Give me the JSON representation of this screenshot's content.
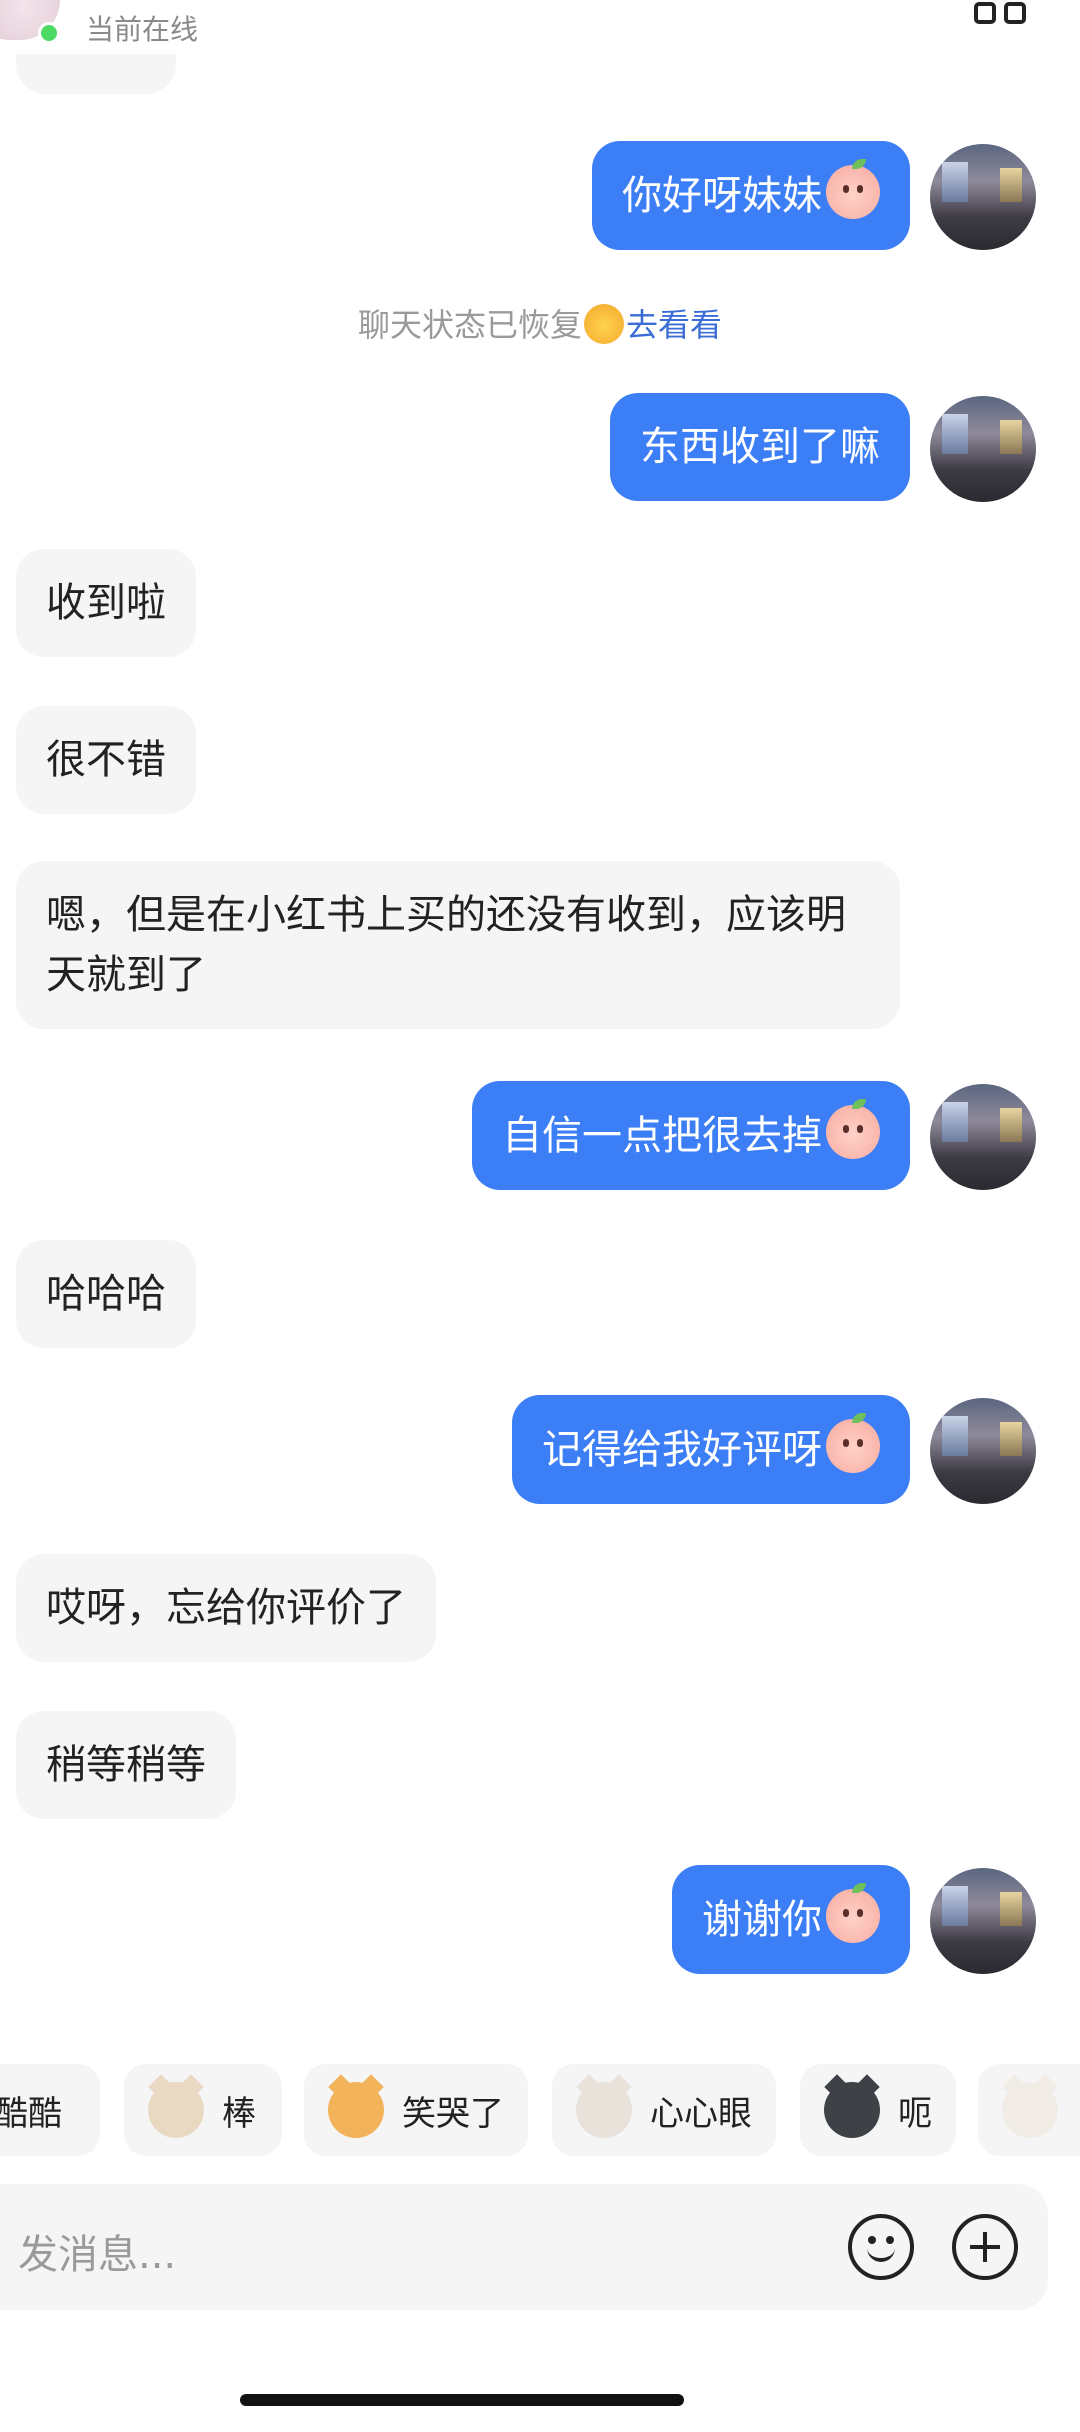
{
  "header": {
    "status_text": "当前在线",
    "menu_icon": "grid-icon"
  },
  "system_note": {
    "text": "聊天状态已恢复",
    "emoji": "star-eyes-emoji",
    "link": "去看看"
  },
  "messages": [
    {
      "side": "out",
      "text": "你好呀妹妹",
      "emoji": "peach-smile-emoji"
    },
    {
      "side": "out",
      "text": "东西收到了嘛"
    },
    {
      "side": "in",
      "text": "收到啦"
    },
    {
      "side": "in",
      "text": "很不错"
    },
    {
      "side": "in",
      "text": "嗯，但是在小红书上买的还没有收到，应该明天就到了"
    },
    {
      "side": "out",
      "text": "自信一点把很去掉",
      "emoji": "peach-cry-emoji"
    },
    {
      "side": "in",
      "text": "哈哈哈"
    },
    {
      "side": "out",
      "text": "记得给我好评呀",
      "emoji": "peach-laugh-emoji"
    },
    {
      "side": "in",
      "text": "哎呀，忘给你评价了"
    },
    {
      "side": "in",
      "text": "稍等稍等"
    },
    {
      "side": "out",
      "text": "谢谢你",
      "emoji": "peach-shy-emoji"
    }
  ],
  "sticker_bar": {
    "items": [
      {
        "label": "酷酷",
        "icon": "cool-cat-icon"
      },
      {
        "label": "棒",
        "icon": "siamese-cat-icon"
      },
      {
        "label": "笑哭了",
        "icon": "orange-cat-laugh-cry-icon"
      },
      {
        "label": "心心眼",
        "icon": "calico-cat-heart-eyes-icon"
      },
      {
        "label": "呃",
        "icon": "black-cat-icon"
      },
      {
        "label": "",
        "icon": "white-cat-icon"
      }
    ]
  },
  "input": {
    "placeholder": "发消息..."
  },
  "colors": {
    "outgoing_bubble": "#3b7ef6",
    "incoming_bubble": "#f5f5f5",
    "link": "#3b6dd6",
    "online_dot": "#4cd964"
  }
}
